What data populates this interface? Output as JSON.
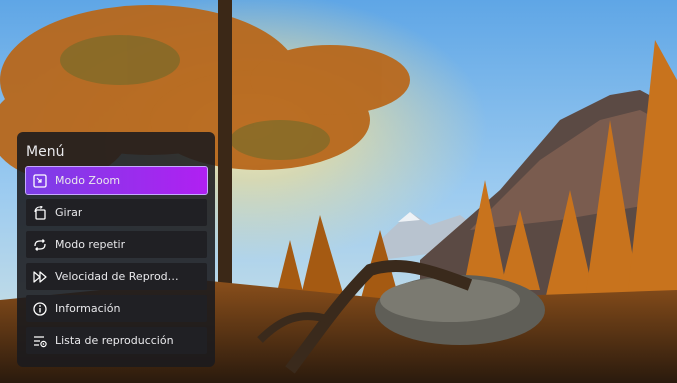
{
  "menu": {
    "title": "Menú",
    "items": [
      {
        "label": "Modo Zoom",
        "icon": "zoom-mode-icon",
        "active": true
      },
      {
        "label": "Girar",
        "icon": "rotate-icon",
        "active": false
      },
      {
        "label": "Modo repetir",
        "icon": "repeat-icon",
        "active": false
      },
      {
        "label": "Velocidad de Reprod…",
        "icon": "fast-forward-icon",
        "active": false
      },
      {
        "label": "Información",
        "icon": "info-icon",
        "active": false
      },
      {
        "label": "Lista de reproducción",
        "icon": "playlist-icon",
        "active": false
      }
    ]
  },
  "colors": {
    "accent_start": "#7b3fe6",
    "accent_end": "#b020f2",
    "panel": "#1a1a1e"
  }
}
